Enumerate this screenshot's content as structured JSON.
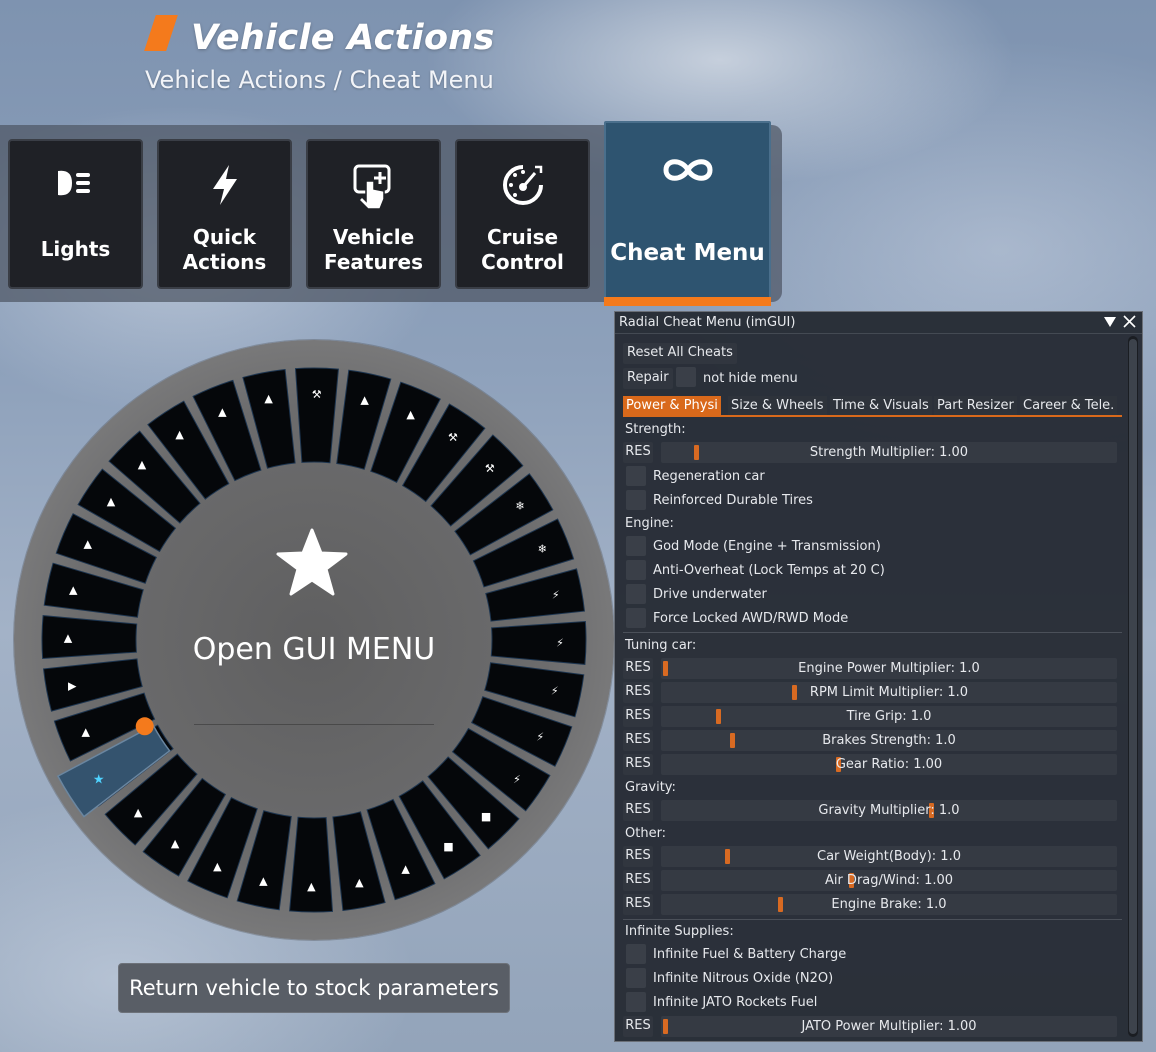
{
  "header": {
    "title": "Vehicle Actions",
    "breadcrumb": "Vehicle Actions / Cheat Menu",
    "accent_color": "#f47a1c"
  },
  "action_bar": {
    "tiles": [
      {
        "label": "Lights",
        "icon": "headlight-icon"
      },
      {
        "label": "Quick\nActions",
        "icon": "lightning-icon"
      },
      {
        "label": "Vehicle\nFeatures",
        "icon": "touch-plus-icon"
      },
      {
        "label": "Cruise\nControl",
        "icon": "speedometer-icon"
      },
      {
        "label": "Cheat Menu",
        "icon": "infinity-icon",
        "active": true
      }
    ]
  },
  "radial": {
    "center_label": "Open GUI MENU",
    "center_icon": "star-icon",
    "return_button": "Return vehicle to stock parameters"
  },
  "imgui": {
    "title": "Radial Cheat Menu (imGUI)",
    "reset_all": "Reset All Cheats",
    "repair": "Repair",
    "not_hide_menu": "not hide menu",
    "tabs": [
      "Power & Physi",
      "Size & Wheels",
      "Time & Visuals",
      "Part Resizer",
      "Career & Tele."
    ],
    "active_tab": "Power & Physi",
    "res_label": "RES",
    "sections": {
      "strength": "Strength:",
      "engine": "Engine:",
      "tuning": "Tuning car:",
      "gravity": "Gravity:",
      "other": "Other:",
      "infinite": "Infinite Supplies:"
    },
    "strength_slider": {
      "label": "Strength Multiplier: 1.00",
      "fill": 0.07
    },
    "strength_checks": [
      "Regeneration car",
      "Reinforced Durable Tires"
    ],
    "engine_checks": [
      "God Mode (Engine + Transmission)",
      "Anti-Overheat (Lock Temps at 20 C)",
      "Drive underwater",
      "Force Locked AWD/RWD Mode"
    ],
    "tuning_sliders": [
      {
        "label": "Engine Power Multiplier: 1.0",
        "fill": 0.0
      },
      {
        "label": "RPM Limit Multiplier: 1.0",
        "fill": 0.29
      },
      {
        "label": "Tire Grip: 1.0",
        "fill": 0.12
      },
      {
        "label": "Brakes Strength: 1.0",
        "fill": 0.15
      },
      {
        "label": "Gear Ratio: 1.00",
        "fill": 0.39
      }
    ],
    "gravity_slider": {
      "label": "Gravity Multiplier: 1.0",
      "fill": 0.6
    },
    "other_sliders": [
      {
        "label": "Car Weight(Body): 1.0",
        "fill": 0.14
      },
      {
        "label": "Air Drag/Wind: 1.00",
        "fill": 0.42
      },
      {
        "label": "Engine Brake: 1.0",
        "fill": 0.26
      }
    ],
    "infinite_checks": [
      "Infinite Fuel & Battery Charge",
      "Infinite Nitrous Oxide (N2O)",
      "Infinite JATO Rockets Fuel"
    ],
    "jato_slider": {
      "label": "JATO Power Multiplier: 1.00",
      "fill": 0.0
    }
  }
}
